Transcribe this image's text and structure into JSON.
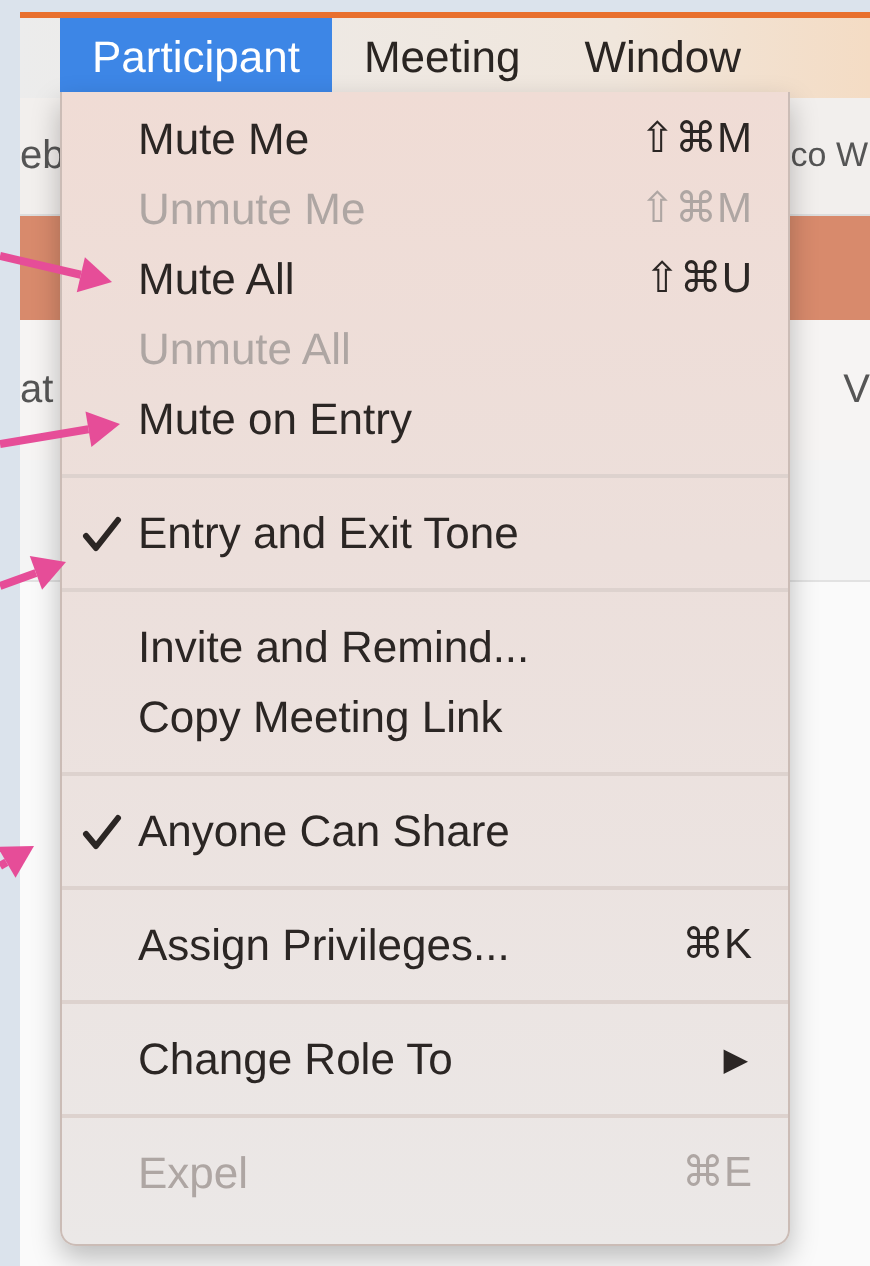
{
  "menu_bar": {
    "items": [
      {
        "label": "Participant",
        "selected": true
      },
      {
        "label": "Meeting",
        "selected": false
      },
      {
        "label": "Window",
        "selected": false
      }
    ]
  },
  "background_window": {
    "header_left": "eb",
    "header_right": "co W",
    "toolbar_left": "at",
    "toolbar_right": "V"
  },
  "menu": {
    "groups": [
      {
        "items": [
          {
            "kind": "item",
            "label": "Mute Me",
            "shortcut": "⇧⌘M",
            "disabled": false,
            "checked": false,
            "annotated": false
          },
          {
            "kind": "item",
            "label": "Unmute Me",
            "shortcut": "⇧⌘M",
            "disabled": true,
            "checked": false,
            "annotated": false
          },
          {
            "kind": "item",
            "label": "Mute All",
            "shortcut": "⇧⌘U",
            "disabled": false,
            "checked": false,
            "annotated": true
          },
          {
            "kind": "item",
            "label": "Unmute All",
            "disabled": true,
            "checked": false,
            "annotated": false
          },
          {
            "kind": "item",
            "label": "Mute on Entry",
            "disabled": false,
            "checked": false,
            "annotated": true
          }
        ]
      },
      {
        "items": [
          {
            "kind": "item",
            "label": "Entry and Exit Tone",
            "disabled": false,
            "checked": true,
            "annotated": true
          }
        ]
      },
      {
        "items": [
          {
            "kind": "item",
            "label": "Invite and Remind...",
            "disabled": false,
            "checked": false,
            "annotated": false
          },
          {
            "kind": "item",
            "label": "Copy Meeting Link",
            "disabled": false,
            "checked": false,
            "annotated": false
          }
        ]
      },
      {
        "items": [
          {
            "kind": "item",
            "label": "Anyone Can Share",
            "disabled": false,
            "checked": true,
            "annotated": true
          }
        ]
      },
      {
        "items": [
          {
            "kind": "item",
            "label": "Assign Privileges...",
            "shortcut": "⌘K",
            "disabled": false,
            "checked": false,
            "annotated": false
          }
        ]
      },
      {
        "items": [
          {
            "kind": "submenu",
            "label": "Change Role To",
            "arrow": "▶",
            "disabled": false,
            "checked": false,
            "annotated": false
          }
        ]
      },
      {
        "items": [
          {
            "kind": "item",
            "label": "Expel",
            "shortcut": "⌘E",
            "disabled": true,
            "checked": false,
            "annotated": false
          }
        ]
      }
    ]
  }
}
